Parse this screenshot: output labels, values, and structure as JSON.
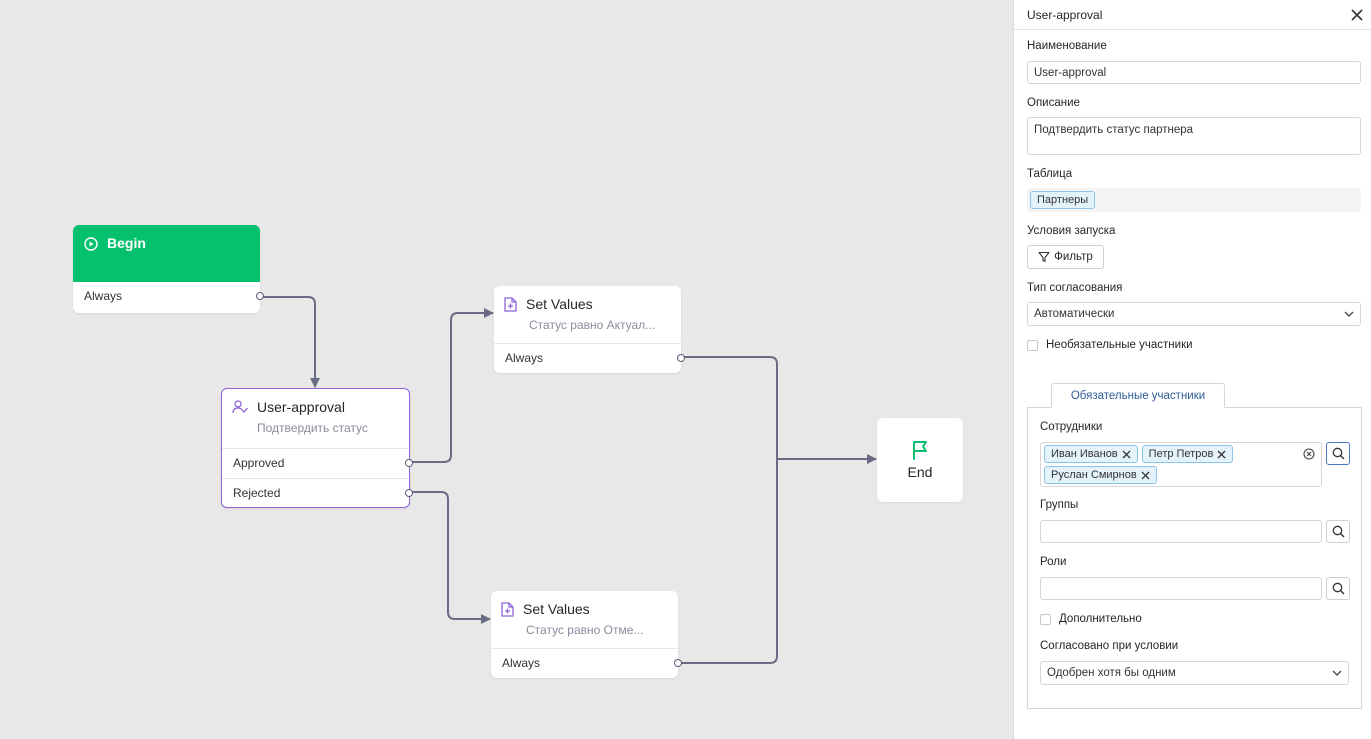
{
  "canvas": {
    "begin": {
      "title": "Begin",
      "outputs": [
        "Always"
      ]
    },
    "approval": {
      "title": "User-approval",
      "subtitle": "Подтвердить статус",
      "outputs": [
        "Approved",
        "Rejected"
      ]
    },
    "set_values_1": {
      "title": "Set Values",
      "subtitle": "Статус равно Актуал...",
      "outputs": [
        "Always"
      ]
    },
    "set_values_2": {
      "title": "Set Values",
      "subtitle": "Статус равно Отме...",
      "outputs": [
        "Always"
      ]
    },
    "end": {
      "title": "End"
    }
  },
  "panel": {
    "header": "User-approval",
    "name_label": "Наименование",
    "name_value": "User-approval",
    "description_label": "Описание",
    "description_value": "Подтвердить статус партнера",
    "table_label": "Таблица",
    "table_value": "Партнеры",
    "launch_label": "Условия запуска",
    "filter_button": "Фильтр",
    "approval_type_label": "Тип согласования",
    "approval_type_value": "Автоматически",
    "optional_participants": "Необязательные участники",
    "tab_label": "Обязательные участники",
    "employees_label": "Сотрудники",
    "employees": [
      "Иван Иванов",
      "Петр Петров",
      "Руслан Смирнов"
    ],
    "groups_label": "Группы",
    "roles_label": "Роли",
    "additional_label": "Дополнительно",
    "condition_label": "Согласовано при условии",
    "condition_value": "Одобрен хотя бы одним"
  },
  "colors": {
    "begin": "#05c16e",
    "approval_border": "#8e63d8",
    "edge": "#6b6b85",
    "end_flag": "#05c16e",
    "tag_bg": "#e4f2fb",
    "tag_border": "#8cc4e6"
  }
}
